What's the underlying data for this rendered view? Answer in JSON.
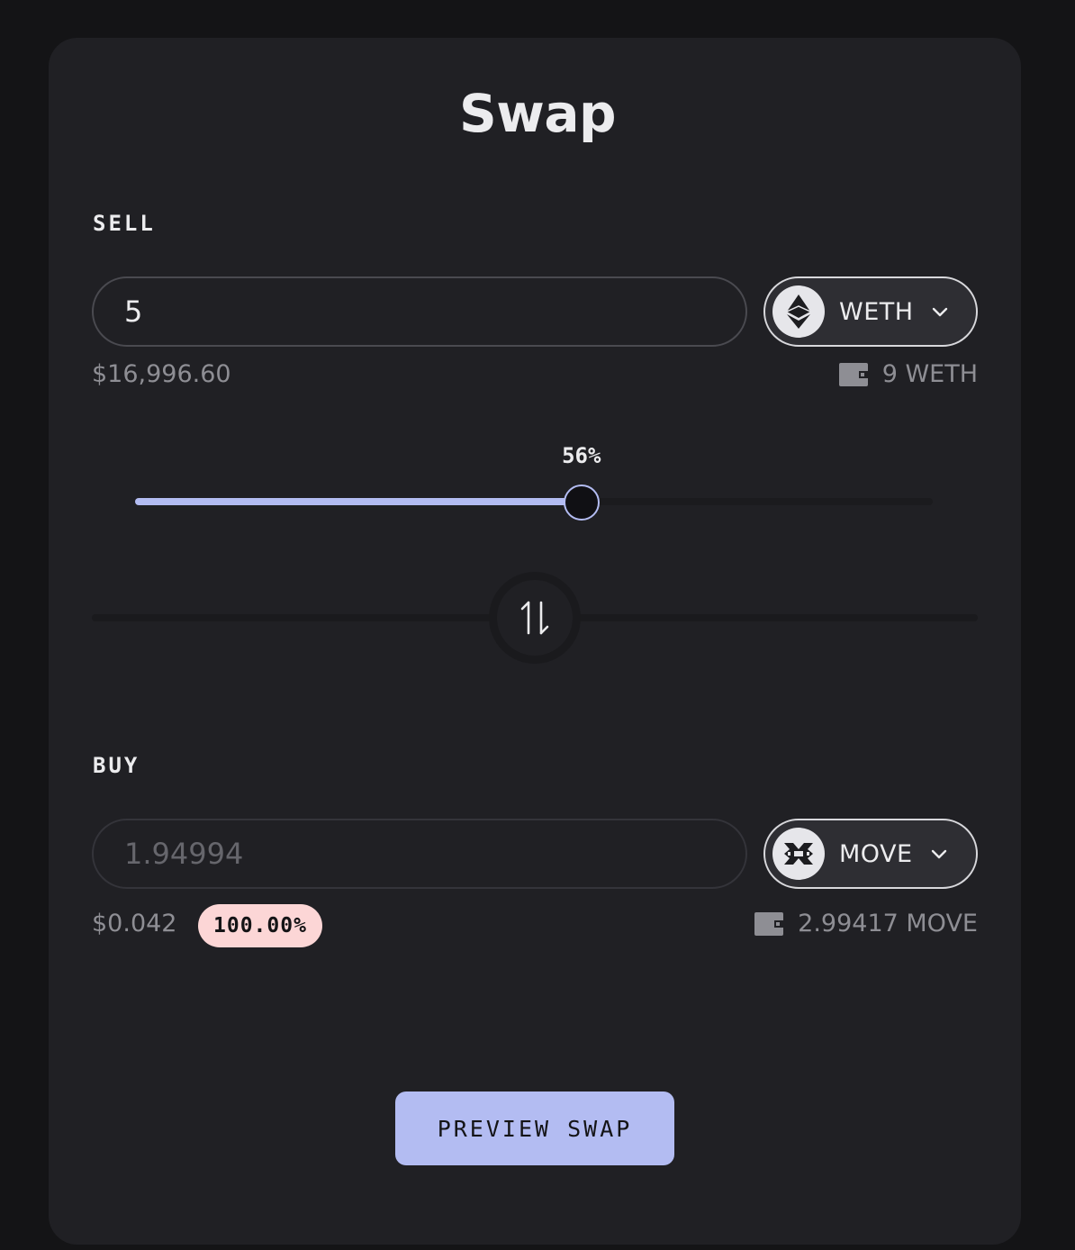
{
  "title": "Swap",
  "sell": {
    "label": "SELL",
    "amount": "5",
    "usd_value": "$16,996.60",
    "token": {
      "symbol": "WETH",
      "icon": "ethereum-icon"
    },
    "balance": "9 WETH"
  },
  "slider": {
    "percent_label": "56%",
    "value_fraction": 0.56
  },
  "buy": {
    "label": "BUY",
    "amount": "1.94994",
    "usd_value": "$0.042",
    "price_impact": "100.00%",
    "token": {
      "symbol": "MOVE",
      "icon": "movement-icon"
    },
    "balance": "2.99417 MOVE"
  },
  "preview_button": "PREVIEW SWAP",
  "colors": {
    "accent": "#b3bcf2",
    "card_bg": "#202024",
    "page_bg": "#141416",
    "impact_badge": "#fcd6d6"
  }
}
